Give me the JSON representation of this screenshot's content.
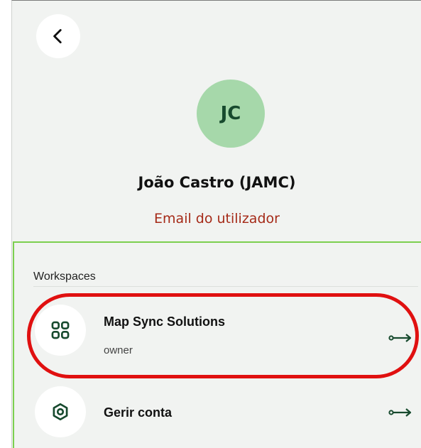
{
  "user": {
    "initials": "JC",
    "name": "João Castro (JAMC)",
    "email_label": "Email do utilizador"
  },
  "workspaces": {
    "section_title": "Workspaces",
    "items": [
      {
        "title": "Map Sync Solutions",
        "subtitle": "owner",
        "icon": "grid-icon"
      }
    ]
  },
  "account": {
    "manage_label": "Gerir conta",
    "icon": "settings-hexagon-icon"
  },
  "colors": {
    "accent": "#174a2e",
    "avatar_bg": "#a6d8aa",
    "email_text": "#a52a18",
    "panel_border": "#7ccf4f",
    "highlight": "#e01010"
  }
}
